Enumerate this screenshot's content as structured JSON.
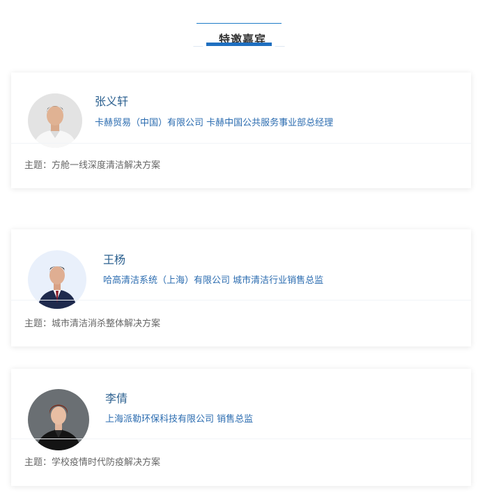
{
  "section": {
    "title": "特邀嘉宾",
    "accent_color": "#1e6fc0"
  },
  "guests": [
    {
      "name": "张义轩",
      "org": "卡赫贸易（中国）有限公司 卡赫中国公共服务事业部总经理",
      "topic": "主题：方舱一线深度清洁解决方案",
      "avatar_icon": "portrait-man-white-shirt"
    },
    {
      "name": "王杨",
      "org": "哈高清洁系统（上海）有限公司 城市清洁行业销售总监",
      "topic": "主题：城市清洁消杀整体解决方案",
      "avatar_icon": "portrait-man-navy-suit"
    },
    {
      "name": "李倩",
      "org": "上海派勒环保科技有限公司   销售总监",
      "topic": "主题：学校疫情时代防疫解决方案",
      "avatar_icon": "portrait-woman-black-jacket"
    }
  ],
  "colors": {
    "name": "#2a5f8f",
    "org": "#2b6cb0",
    "topic": "#666666"
  }
}
